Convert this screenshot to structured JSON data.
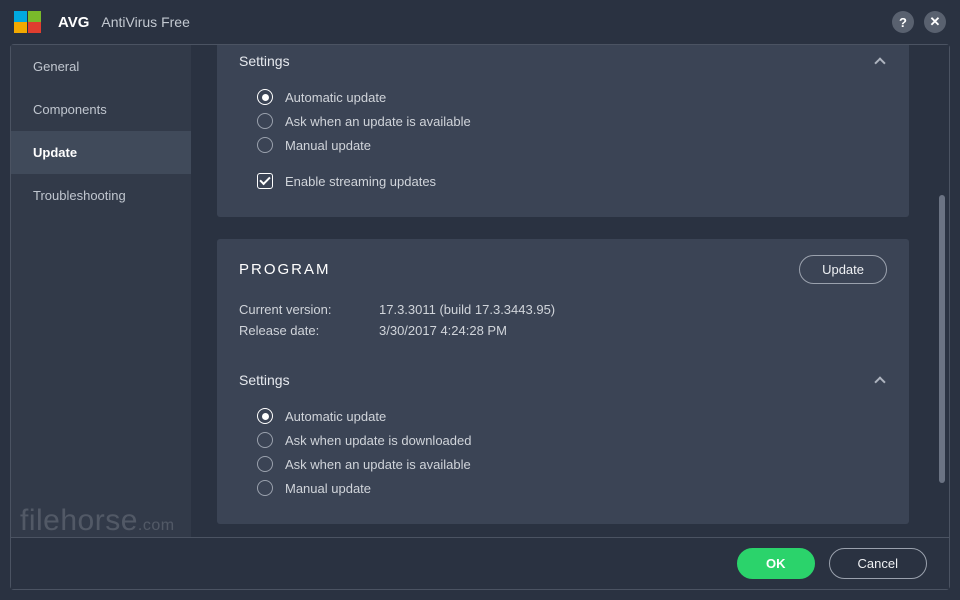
{
  "titlebar": {
    "brand": "AVG",
    "product": "AntiVirus Free",
    "help_label": "?",
    "close_label": "✕"
  },
  "sidebar": {
    "items": [
      {
        "label": "General",
        "active": false
      },
      {
        "label": "Components",
        "active": false
      },
      {
        "label": "Update",
        "active": true
      },
      {
        "label": "Troubleshooting",
        "active": false
      }
    ]
  },
  "panels": {
    "first_settings": {
      "title": "Settings",
      "options": [
        {
          "type": "radio",
          "selected": true,
          "label": "Automatic update"
        },
        {
          "type": "radio",
          "selected": false,
          "label": "Ask when an update is available"
        },
        {
          "type": "radio",
          "selected": false,
          "label": "Manual update"
        },
        {
          "type": "checkbox",
          "selected": true,
          "label": "Enable streaming updates",
          "gap": true
        }
      ]
    },
    "program": {
      "title": "PROGRAM",
      "update_button": "Update",
      "rows": [
        {
          "key": "Current version:",
          "val": "17.3.3011 (build 17.3.3443.95)"
        },
        {
          "key": "Release date:",
          "val": "3/30/2017 4:24:28 PM"
        }
      ],
      "settings_title": "Settings",
      "options": [
        {
          "type": "radio",
          "selected": true,
          "label": "Automatic update"
        },
        {
          "type": "radio",
          "selected": false,
          "label": "Ask when update is downloaded"
        },
        {
          "type": "radio",
          "selected": false,
          "label": "Ask when an update is available"
        },
        {
          "type": "radio",
          "selected": false,
          "label": "Manual update"
        }
      ]
    }
  },
  "footer": {
    "ok": "OK",
    "cancel": "Cancel"
  },
  "watermark": {
    "name": "filehorse",
    "suffix": ".com"
  }
}
